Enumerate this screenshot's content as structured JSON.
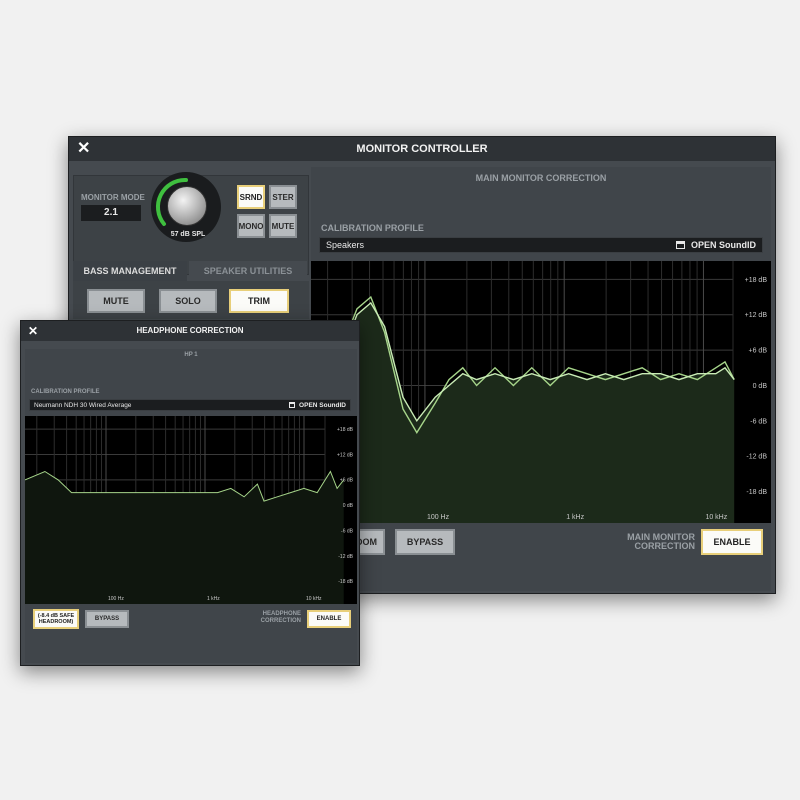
{
  "main_window": {
    "title": "MONITOR CONTROLLER",
    "close_glyph": "✕",
    "monitor_mode_label": "MONITOR MODE",
    "monitor_mode_value": "2.1",
    "spl": "57 dB SPL",
    "mode_buttons": {
      "srnd": "SRND",
      "ster": "STER",
      "mono": "MONO",
      "mute": "MUTE"
    },
    "tabs": {
      "bass_management": "BASS MANAGEMENT",
      "speaker_utilities": "SPEAKER UTILITIES"
    },
    "bass_buttons": {
      "mute": "MUTE",
      "solo": "SOLO",
      "trim": "TRIM"
    },
    "section_title": "MAIN MONITOR CORRECTION",
    "calibration_label": "CALIBRATION PROFILE",
    "profile": "Speakers",
    "open_soundid": "OPEN SoundID",
    "db_ticks": [
      "+18 dB",
      "+12 dB",
      "+6 dB",
      "0 dB",
      "-6 dB",
      "-12 dB",
      "-18 dB"
    ],
    "freq_ticks": [
      "100 Hz",
      "1 kHz",
      "10 kHz"
    ],
    "headroom_partial": "OOM",
    "bypass": "BYPASS",
    "correction_label_1": "MAIN MONITOR",
    "correction_label_2": "CORRECTION",
    "enable": "ENABLE"
  },
  "hp_window": {
    "title": "HEADPHONE CORRECTION",
    "close_glyph": "✕",
    "hp_label": "HP 1",
    "calibration_label": "CALIBRATION PROFILE",
    "profile": "Neumann NDH 30 Wired Average",
    "open_soundid": "OPEN SoundID",
    "db_ticks": [
      "+18 dB",
      "+12 dB",
      "+6 dB",
      "0 dB",
      "-6 dB",
      "-12 dB",
      "-18 dB"
    ],
    "freq_ticks": [
      "100 Hz",
      "1 kHz",
      "10 kHz"
    ],
    "headroom_1": "(-8.4 dB SAFE",
    "headroom_2": "HEADROOM)",
    "bypass": "BYPASS",
    "correction_label_1": "HEADPHONE",
    "correction_label_2": "CORRECTION",
    "enable": "ENABLE"
  },
  "colors": {
    "curve": "#a6d58a",
    "curve_fill": "#1c2a1a",
    "active_border": "#e8cf7a",
    "knob_ring": "#3fbf3f"
  }
}
